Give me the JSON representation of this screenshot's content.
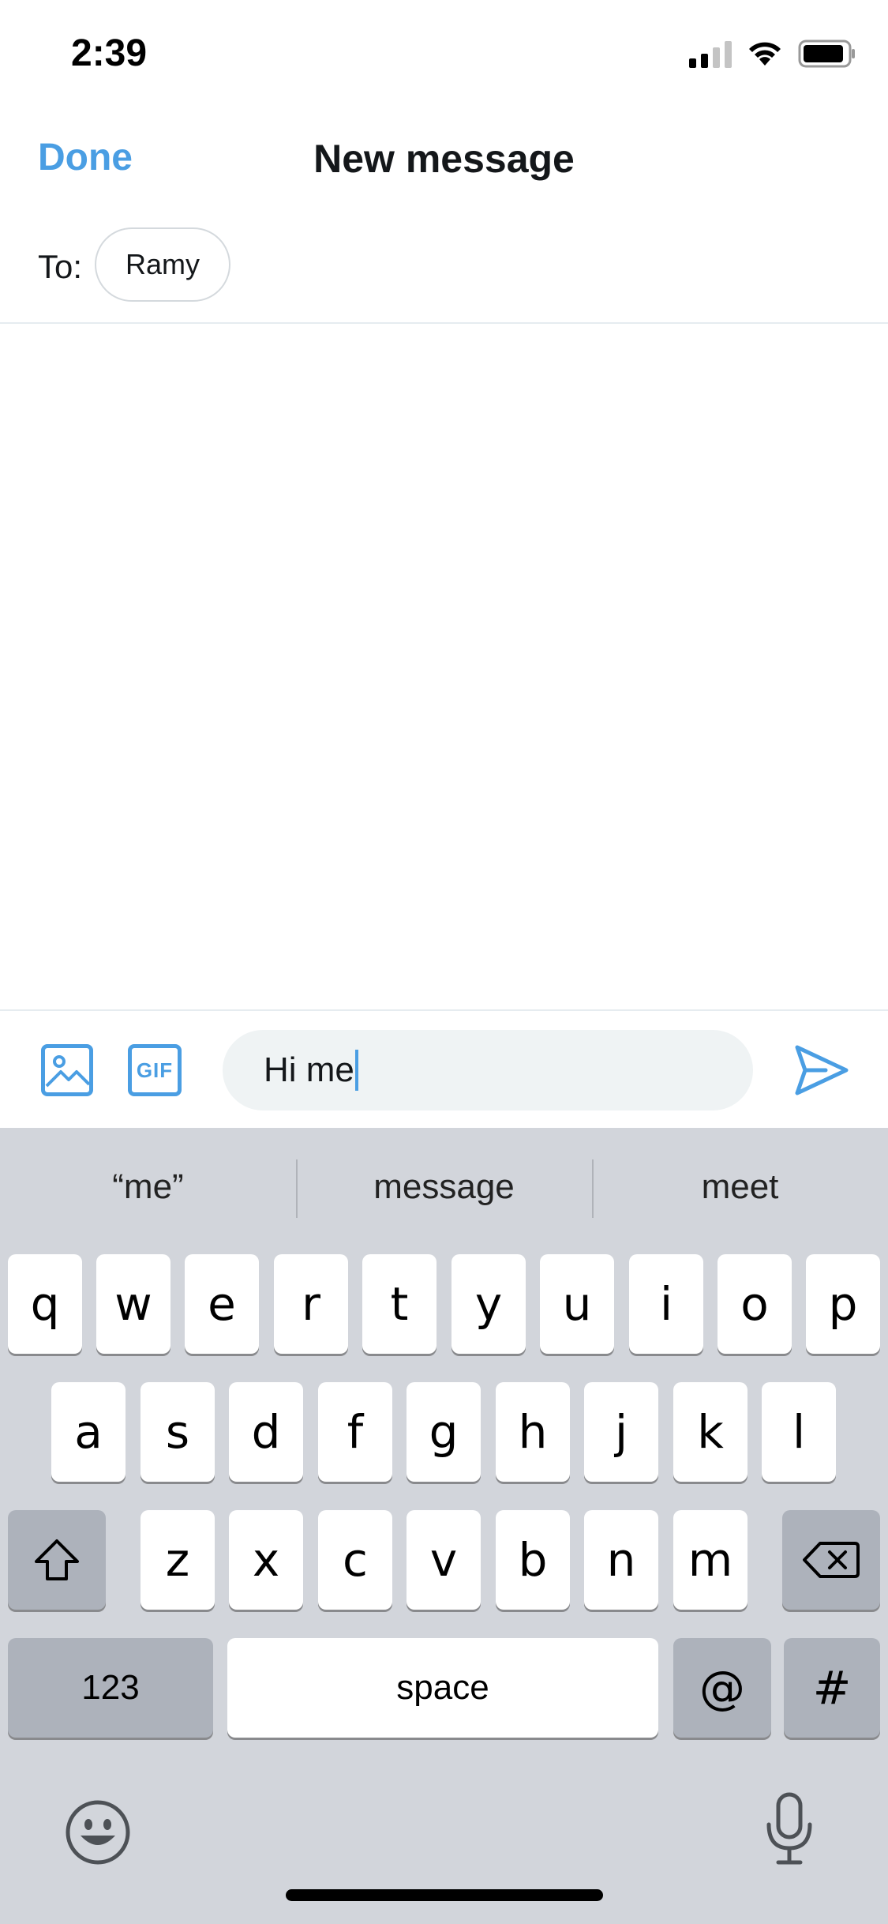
{
  "status_bar": {
    "time": "2:39"
  },
  "header": {
    "done_label": "Done",
    "title": "New message"
  },
  "recipients": {
    "to_label": "To:",
    "chips": [
      "Ramy"
    ]
  },
  "composer": {
    "input_value": "Hi me",
    "image_icon": "image-icon",
    "gif_label": "GIF",
    "send_icon": "send-icon"
  },
  "keyboard": {
    "suggestions": [
      "“me”",
      "message",
      "meet"
    ],
    "row1": [
      "q",
      "w",
      "e",
      "r",
      "t",
      "y",
      "u",
      "i",
      "o",
      "p"
    ],
    "row2": [
      "a",
      "s",
      "d",
      "f",
      "g",
      "h",
      "j",
      "k",
      "l"
    ],
    "row3": [
      "z",
      "x",
      "c",
      "v",
      "b",
      "n",
      "m"
    ],
    "numbers_label": "123",
    "space_label": "space",
    "at_label": "@",
    "hash_label": "#"
  },
  "colors": {
    "accent": "#4a9ee3",
    "keyboard_bg": "#d2d5db"
  }
}
